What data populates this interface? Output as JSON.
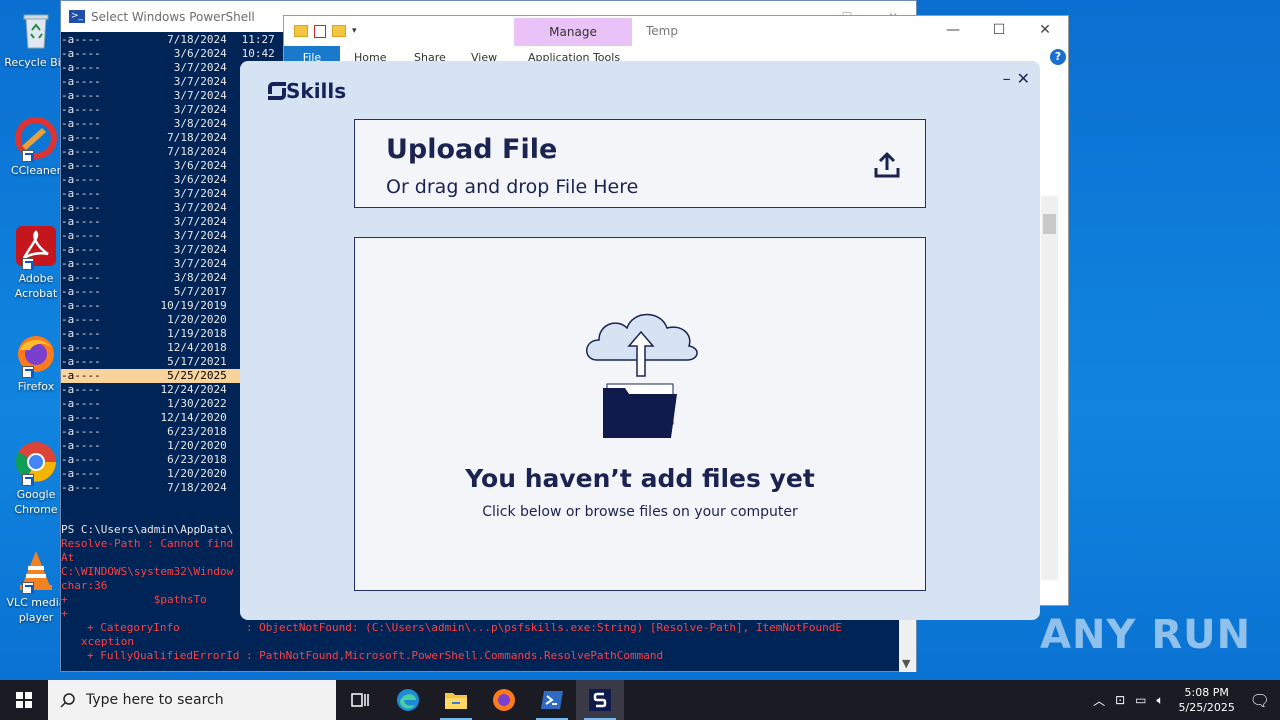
{
  "desktop": {
    "icons": [
      {
        "label": "Recycle Bin",
        "icon": "recycle-bin-icon"
      },
      {
        "label": "CCleaner",
        "icon": "ccleaner-icon"
      },
      {
        "label": "Adobe Acrobat",
        "icon": "adobe-acrobat-icon"
      },
      {
        "label": "Firefox",
        "icon": "firefox-icon"
      },
      {
        "label": "Google Chrome",
        "icon": "chrome-icon"
      },
      {
        "label": "VLC media player",
        "icon": "vlc-icon"
      }
    ]
  },
  "powershell": {
    "title": "Select Windows PowerShell",
    "rows": [
      {
        "mode": "-a----",
        "date": "7/18/2024",
        "time": "11:27"
      },
      {
        "mode": "-a----",
        "date": "3/6/2024",
        "time": "10:42"
      },
      {
        "mode": "-a----",
        "date": "3/7/2024",
        "time": ""
      },
      {
        "mode": "-a----",
        "date": "3/7/2024",
        "time": ""
      },
      {
        "mode": "-a----",
        "date": "3/7/2024",
        "time": ""
      },
      {
        "mode": "-a----",
        "date": "3/7/2024",
        "time": ""
      },
      {
        "mode": "-a----",
        "date": "3/8/2024",
        "time": ""
      },
      {
        "mode": "-a----",
        "date": "7/18/2024",
        "time": ""
      },
      {
        "mode": "-a----",
        "date": "7/18/2024",
        "time": ""
      },
      {
        "mode": "-a----",
        "date": "3/6/2024",
        "time": ""
      },
      {
        "mode": "-a----",
        "date": "3/6/2024",
        "time": ""
      },
      {
        "mode": "-a----",
        "date": "3/7/2024",
        "time": ""
      },
      {
        "mode": "-a----",
        "date": "3/7/2024",
        "time": ""
      },
      {
        "mode": "-a----",
        "date": "3/7/2024",
        "time": ""
      },
      {
        "mode": "-a----",
        "date": "3/7/2024",
        "time": ""
      },
      {
        "mode": "-a----",
        "date": "3/7/2024",
        "time": ""
      },
      {
        "mode": "-a----",
        "date": "3/7/2024",
        "time": ""
      },
      {
        "mode": "-a----",
        "date": "3/8/2024",
        "time": ""
      },
      {
        "mode": "-a----",
        "date": "5/7/2017",
        "time": ""
      },
      {
        "mode": "-a----",
        "date": "10/19/2019",
        "time": ""
      },
      {
        "mode": "-a----",
        "date": "1/20/2020",
        "time": ""
      },
      {
        "mode": "-a----",
        "date": "1/19/2018",
        "time": ""
      },
      {
        "mode": "-a----",
        "date": "12/4/2018",
        "time": ""
      },
      {
        "mode": "-a----",
        "date": "5/17/2021",
        "time": ""
      },
      {
        "mode": "-a----",
        "date": "5/25/2025",
        "time": "",
        "selected": true
      },
      {
        "mode": "-a----",
        "date": "12/24/2024",
        "time": ""
      },
      {
        "mode": "-a----",
        "date": "1/30/2022",
        "time": ""
      },
      {
        "mode": "-a----",
        "date": "12/14/2020",
        "time": ""
      },
      {
        "mode": "-a----",
        "date": "6/23/2018",
        "time": ""
      },
      {
        "mode": "-a----",
        "date": "1/20/2020",
        "time": ""
      },
      {
        "mode": "-a----",
        "date": "6/23/2018",
        "time": ""
      },
      {
        "mode": "-a----",
        "date": "1/20/2020",
        "time": ""
      },
      {
        "mode": "-a----",
        "date": "7/18/2024",
        "time": ""
      }
    ],
    "prompt": "PS C:\\Users\\admin\\AppData\\",
    "error_lines": [
      "Resolve-Path : Cannot find",
      "At",
      "C:\\WINDOWS\\system32\\Window",
      "char:36",
      "+             $pathsTo",
      "+"
    ],
    "category_info": "+ CategoryInfo          : ObjectNotFound: (C:\\Users\\admin\\...p\\psfskills.exe:String) [Resolve-Path], ItemNotFoundE",
    "category_info_cont": "xception",
    "fqid": "+ FullyQualifiedErrorId : PathNotFound,Microsoft.PowerShell.Commands.ResolvePathCommand"
  },
  "explorer": {
    "manage_tab": "Manage",
    "title": "Temp",
    "tabs": [
      "File",
      "Home",
      "Share",
      "View",
      "Application Tools"
    ]
  },
  "skills": {
    "logo_text": "Skills",
    "upload_title": "Upload File",
    "upload_subtitle": "Or drag and drop File Here",
    "empty_title": "You haven’t add files yet",
    "empty_subtitle": "Click below or browse files on your computer"
  },
  "taskbar": {
    "search_placeholder": "Type here to search",
    "time": "5:08 PM",
    "date": "5/25/2025"
  },
  "watermark": "ANY RUN",
  "colors": {
    "dialog_bg": "#d6e3f3",
    "navy": "#1b2450",
    "ps_bg": "#012456",
    "selection": "#f8d39c",
    "error": "#ff4040"
  }
}
